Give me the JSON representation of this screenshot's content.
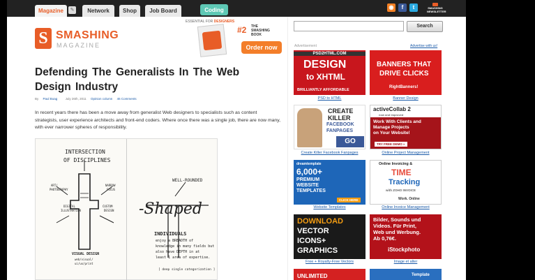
{
  "nav": {
    "tabs": [
      "Magazine",
      "Network",
      "Shop",
      "Job Board"
    ],
    "coding": "Coding"
  },
  "header": {
    "logo_main": "SMASHING",
    "logo_sub": "MAGAZINE",
    "newsletter": "SMASHING NEWSLETTER"
  },
  "book_ad": {
    "essential": "ESSENTIAL FOR",
    "audience": "DESIGNERS",
    "number": "#2",
    "line1": "THE",
    "line2": "SMASHING",
    "line3": "BOOK",
    "order": "Order now"
  },
  "article": {
    "title": "Defending The Generalists In The Web Design Industry",
    "by": "By",
    "author": "Paul Boag",
    "date": "July 26th, 2011",
    "category": "Opinion column",
    "comments": "46 Comments",
    "intro": "In recent years there has been a move away from generalist Web designers to specialists such as content strategists, user experience architects and front-end coders. Where once there was a single job, there are now many, with ever narrower spheres of responsibility.",
    "sketch": {
      "heading1": "INTERSECTION",
      "heading2": "OF DISCIPLINES",
      "left_labels": [
        "ART/",
        "PHOTOGRAPHY",
        "DIGITAL",
        "ILLUSTRATION"
      ],
      "right_labels": [
        "NARROW",
        "FOCUS",
        "CUSTOM",
        "DESIGN"
      ],
      "vd1": "VISUAL DESIGN",
      "vd2": "web/visual/",
      "vd3": "ui/ux/print",
      "well": "WELL-ROUNDED",
      "shaped": "-Shaped",
      "ind1": "INDIVIDUALS",
      "ind2": "enjoy a BREADTH of",
      "ind3": "knowledge in many fields but",
      "ind4": "also have DEPTH in at",
      "ind5": "least 1 area of expertise.",
      "ind6": "[ deep single categorization ]"
    }
  },
  "sidebar": {
    "search_placeholder": "",
    "search_button": "Search",
    "ad_label": "Advertisement",
    "advertise": "Advertise with us!",
    "ads": [
      {
        "lines": [
          "PSD2HTML.COM",
          "DESIGN",
          "to XHTML",
          "BRILLIANTLY AFFORDABLE"
        ],
        "caption": "PSD to HTML",
        "bg": "#c8161d"
      },
      {
        "lines": [
          "BANNERS THAT",
          "DRIVE CLICKS",
          "RightBanners!"
        ],
        "caption": "Banner Design",
        "bg": "#d91e1e"
      },
      {
        "lines": [
          "CREATE",
          "KILLER",
          "FACEBOOK",
          "FANPAGES",
          "GO"
        ],
        "caption": "Create Killer Facebook Fanpages",
        "bg": "#ffffff"
      },
      {
        "lines": [
          "activeCollab 2",
          "now and improved",
          "Work With Clients and",
          "Manage Projects",
          "on Your Website!",
          "TRY FREE DEMO »"
        ],
        "caption": "Online Project Management",
        "bg": "#a5141a"
      },
      {
        "lines": [
          "dreamtemplate",
          "6,000+",
          "PREMIUM",
          "WEBSITE",
          "TEMPLATES",
          "CLICK HERE"
        ],
        "caption": "Website Templates",
        "bg": "#1e66b8"
      },
      {
        "lines": [
          "Online Invoicing &",
          "TIME",
          "Tracking",
          "with ZOHO INVOICE",
          "Work. Online"
        ],
        "caption": "Online Invoice Management",
        "bg": "#ffffff"
      },
      {
        "lines": [
          "DOWNLOAD",
          "VECTOR",
          "ICONS+",
          "GRAPHICS"
        ],
        "caption": "Free + Royalty-Free Vectors",
        "bg": "#1a1a1a"
      },
      {
        "lines": [
          "Bilder, Sounds und",
          "Videos. Für Print,",
          "Web und Werbung.",
          "Ab 0,76€.",
          "iStockphoto"
        ],
        "caption": "Image et alter",
        "bg": "#b3121a"
      },
      {
        "lines": [
          "UNLIMITED"
        ],
        "caption": "",
        "bg": "#d42121"
      },
      {
        "lines": [
          "Template"
        ],
        "caption": "",
        "bg": "#2a6fbf"
      }
    ]
  }
}
